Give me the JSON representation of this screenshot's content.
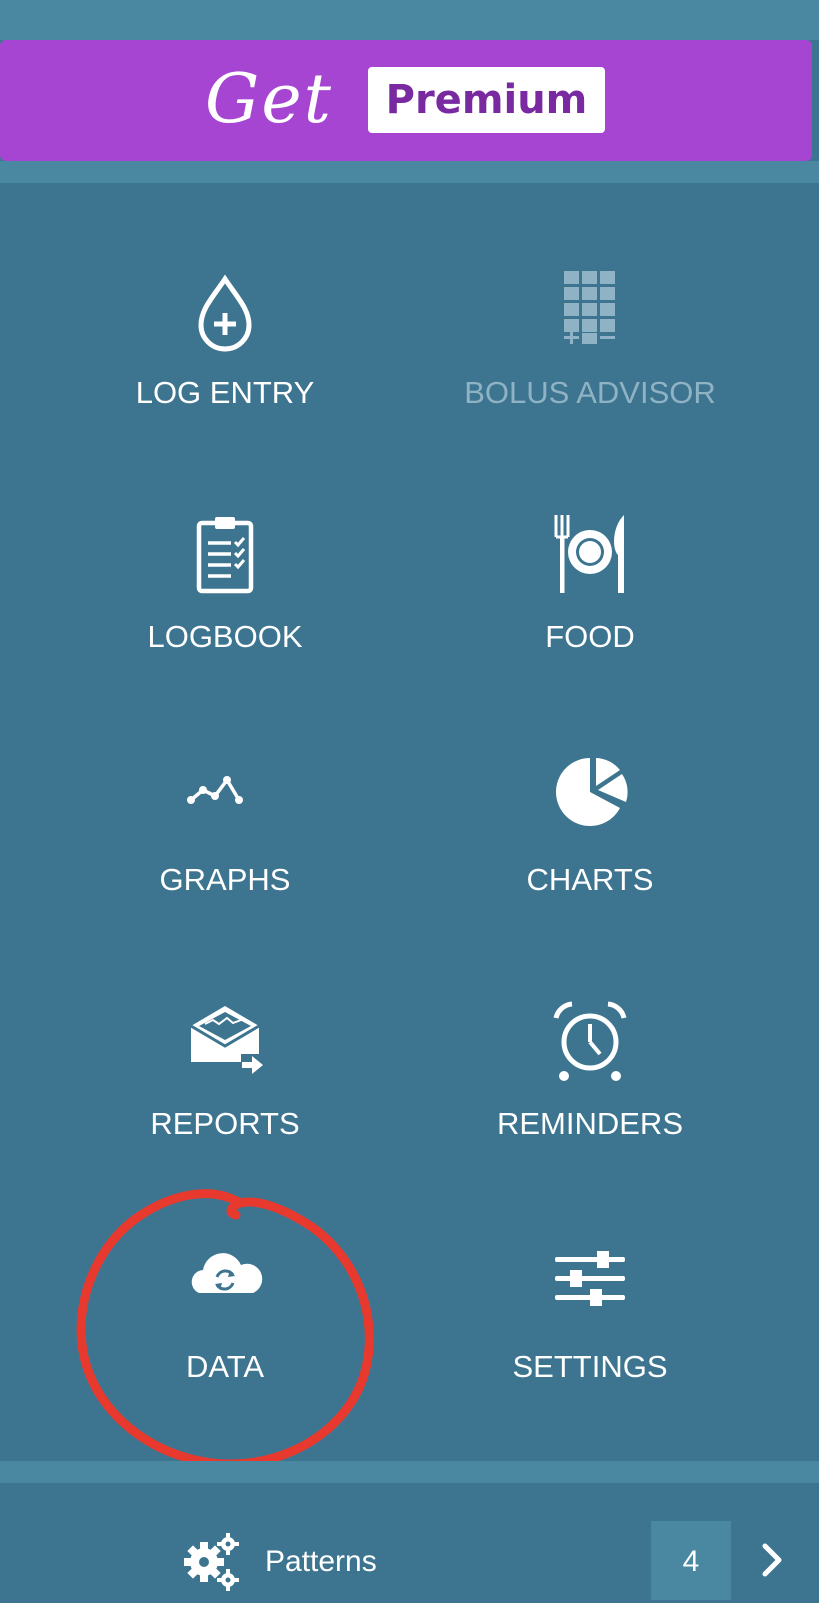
{
  "banner": {
    "get_label": "Get",
    "premium_label": "Premium"
  },
  "menu": {
    "log_entry": "LOG ENTRY",
    "bolus_advisor": "BOLUS ADVISOR",
    "logbook": "LOGBOOK",
    "food": "FOOD",
    "graphs": "GRAPHS",
    "charts": "CHARTS",
    "reports": "REPORTS",
    "reminders": "REMINDERS",
    "data": "DATA",
    "settings": "SETTINGS"
  },
  "bottom": {
    "patterns_label": "Patterns",
    "count": "4"
  },
  "colors": {
    "background": "#3d7590",
    "banner": "#a545d2",
    "premium_text": "#7a2aa0",
    "disabled_text": "#8fb2c4",
    "highlight": "#e8392e"
  },
  "icons": {
    "log_entry": "drop-plus-icon",
    "bolus_advisor": "keypad-icon",
    "logbook": "clipboard-icon",
    "food": "plate-cutlery-icon",
    "graphs": "line-graph-icon",
    "charts": "pie-chart-icon",
    "reports": "envelope-export-icon",
    "reminders": "alarm-clock-icon",
    "data": "cloud-sync-icon",
    "settings": "sliders-icon",
    "patterns": "gears-icon",
    "next": "chevron-right-icon"
  }
}
